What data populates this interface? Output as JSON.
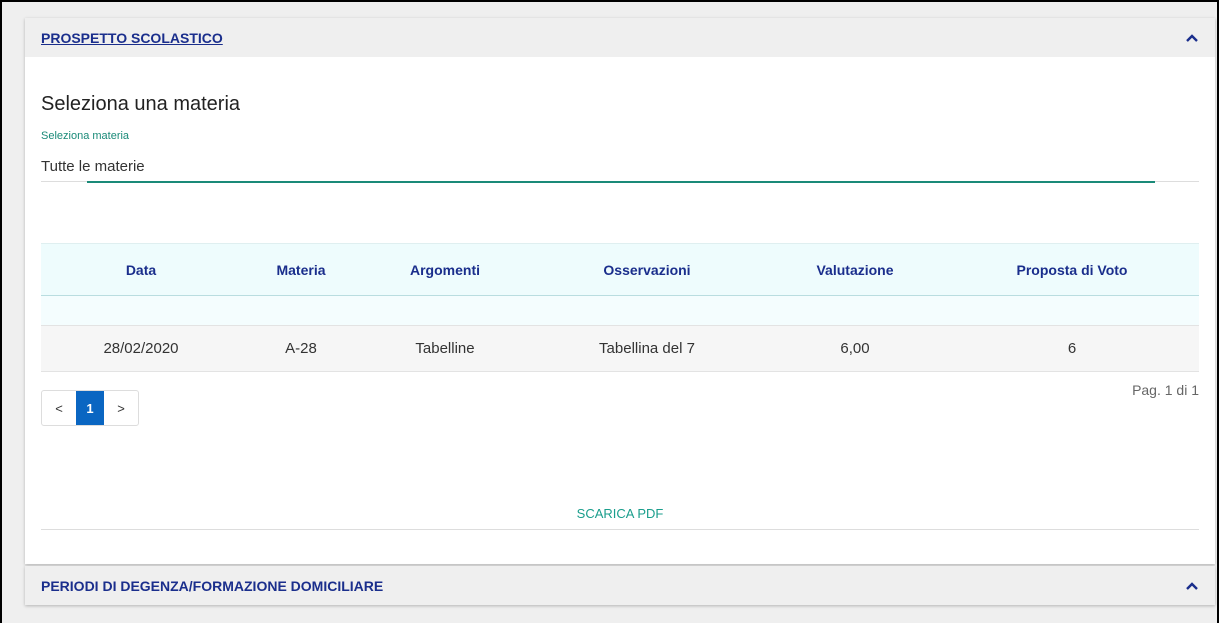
{
  "sections": {
    "prospetto": {
      "title": "PROSPETTO SCOLASTICO"
    },
    "degenza": {
      "title": "PERIODI DI DEGENZA/FORMAZIONE DOMICILIARE"
    }
  },
  "subject_select": {
    "heading": "Seleziona una materia",
    "label": "Seleziona materia",
    "value": "Tutte le materie"
  },
  "table": {
    "headers": [
      "Data",
      "Materia",
      "Argomenti",
      "Osservazioni",
      "Valutazione",
      "Proposta di Voto"
    ],
    "rows": [
      [
        "28/02/2020",
        "A-28",
        "Tabelline",
        "Tabellina del 7",
        "6,00",
        "6"
      ]
    ]
  },
  "pagination": {
    "prev": "<",
    "current": "1",
    "next": ">",
    "info": "Pag. 1 di 1"
  },
  "actions": {
    "download_pdf": "SCARICA PDF"
  },
  "colors": {
    "accent_teal": "#1a8a78",
    "title_blue": "#1a2e8c",
    "page_active": "#0a66c2"
  }
}
